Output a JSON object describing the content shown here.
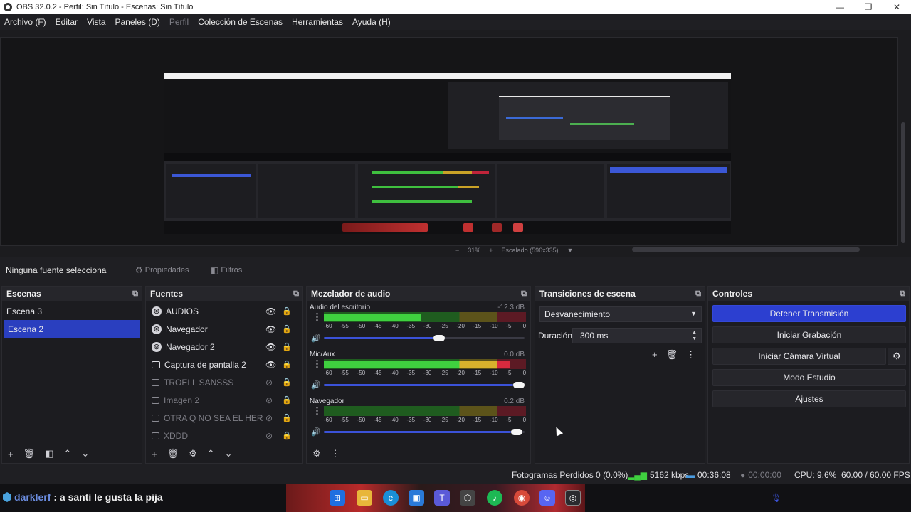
{
  "window": {
    "title": "OBS 32.0.2 - Perfil: Sin Título - Escenas: Sin Título",
    "minimize": "—",
    "maximize": "❐",
    "close": "✕"
  },
  "menu": [
    {
      "label": "Archivo (F)",
      "disabled": false
    },
    {
      "label": "Editar",
      "disabled": false
    },
    {
      "label": "Vista",
      "disabled": false
    },
    {
      "label": "Paneles (D)",
      "disabled": false
    },
    {
      "label": "Perfil",
      "disabled": true
    },
    {
      "label": "Colección de Escenas",
      "disabled": false
    },
    {
      "label": "Herramientas",
      "disabled": false
    },
    {
      "label": "Ayuda (H)",
      "disabled": false
    }
  ],
  "preview": {
    "zoom": "31%",
    "zoom_minus": "−",
    "zoom_plus": "+",
    "scaling": "Escalado (596x335)"
  },
  "context": {
    "selection": "Ninguna fuente selecciona",
    "properties": "Propiedades",
    "filters": "Filtros"
  },
  "scenes": {
    "title": "Escenas",
    "items": [
      {
        "label": "Escena 3",
        "selected": false
      },
      {
        "label": "Escena 2",
        "selected": true
      }
    ]
  },
  "sources": {
    "title": "Fuentes",
    "items": [
      {
        "label": "AUDIOS",
        "icon": "browser-icon",
        "visible": true
      },
      {
        "label": "Navegador",
        "icon": "browser-icon",
        "visible": true
      },
      {
        "label": "Navegador 2",
        "icon": "browser-icon",
        "visible": true
      },
      {
        "label": "Captura de pantalla 2",
        "icon": "display-capture-icon",
        "visible": true
      },
      {
        "label": "TROELL SANSSS",
        "icon": "image-icon",
        "visible": false
      },
      {
        "label": "Imagen 2",
        "icon": "image-icon",
        "visible": false
      },
      {
        "label": "OTRA Q NO SEA EL HERMC",
        "icon": "image-icon",
        "visible": false
      },
      {
        "label": "XDDD",
        "icon": "image-icon",
        "visible": false
      }
    ]
  },
  "mixer": {
    "title": "Mezclador de audio",
    "channels": [
      {
        "name": "Audio del escritorio",
        "db": "-12.3 dB",
        "level": 0.48,
        "volume": 0.58
      },
      {
        "name": "Mic/Aux",
        "db": "0.0 dB",
        "level": 0.92,
        "volume": 1.0
      },
      {
        "name": "Navegador",
        "db": "0.2 dB",
        "level": 0.0,
        "volume": 0.99
      }
    ],
    "ticks": [
      "-60",
      "-55",
      "-50",
      "-45",
      "-40",
      "-35",
      "-30",
      "-25",
      "-20",
      "-15",
      "-10",
      "-5",
      "0"
    ]
  },
  "transitions": {
    "title": "Transiciones de escena",
    "selected": "Desvanecimiento",
    "duration_label": "Duración",
    "duration_value": "300 ms"
  },
  "controls": {
    "title": "Controles",
    "stop_stream": "Detener Transmisión",
    "start_recording": "Iniciar Grabación",
    "start_virtual_cam": "Iniciar Cámara Virtual",
    "studio_mode": "Modo Estudio",
    "settings": "Ajustes"
  },
  "status": {
    "dropped_frames": "Fotogramas Perdidos 0 (0.0%)",
    "bitrate": "5162 kbps",
    "stream_time": "00:36:08",
    "record_time": "00:00:00",
    "cpu": "CPU: 9.6%",
    "fps": "60.00 / 60.00 FPS"
  },
  "chat": {
    "user": "darklerf",
    "message": ": a santi le gusta la pija"
  },
  "colors": {
    "accent": "#2c3fd0",
    "meter_green": "#3fd03f",
    "meter_yellow": "#d8b22c",
    "meter_red": "#d82a3e"
  }
}
